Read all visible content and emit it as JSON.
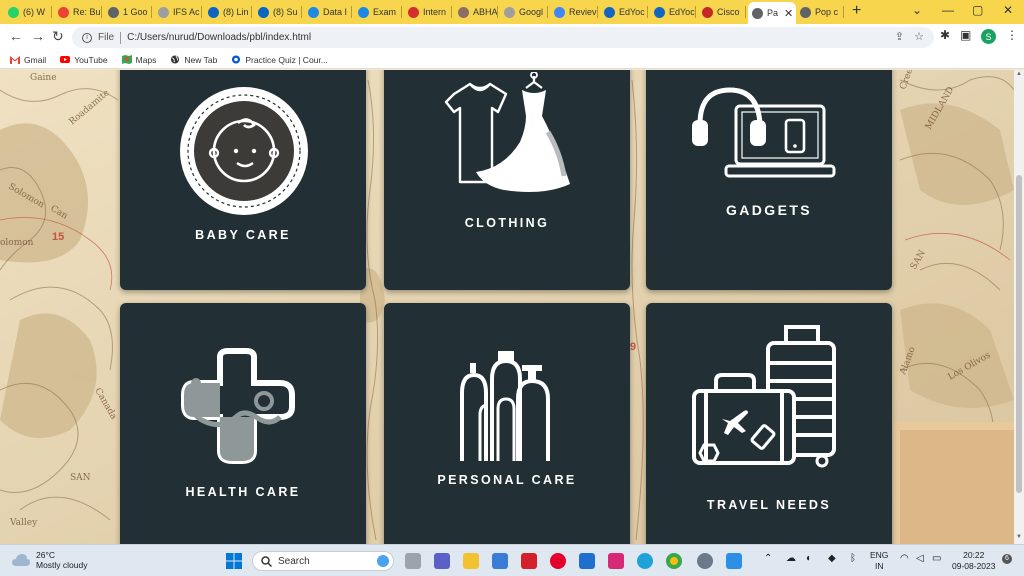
{
  "browser": {
    "tabs": [
      {
        "label": "(6) W",
        "color": "#25d366"
      },
      {
        "label": "Re: Bu",
        "color": "#ea4335"
      },
      {
        "label": "1 Goo",
        "color": "#5f6368"
      },
      {
        "label": "IFS Ac",
        "color": "#9e9e9e"
      },
      {
        "label": "(8) Lin",
        "color": "#0a66c2"
      },
      {
        "label": "(8) Su",
        "color": "#0a66c2"
      },
      {
        "label": "Data I",
        "color": "#1e88e5"
      },
      {
        "label": "Exam",
        "color": "#1e88e5"
      },
      {
        "label": "Intern",
        "color": "#d32f2f"
      },
      {
        "label": "ABHA",
        "color": "#8d6e63"
      },
      {
        "label": "Googl",
        "color": "#9e9e9e"
      },
      {
        "label": "Reviev",
        "color": "#4285f4"
      },
      {
        "label": "EdYoc",
        "color": "#1565c0"
      },
      {
        "label": "EdYoc",
        "color": "#1565c0"
      },
      {
        "label": "Cisco",
        "color": "#c62828"
      },
      {
        "label": "Pa",
        "color": "#5f6368"
      },
      {
        "label": "Pop c",
        "color": "#5f6368"
      }
    ],
    "active_tab_close": "✕",
    "new_tab": "+",
    "url_scheme": "File",
    "url": "C:/Users/nurud/Downloads/pbl/index.html",
    "profile_initial": "S"
  },
  "bookmarks": [
    {
      "label": "Gmail"
    },
    {
      "label": "YouTube"
    },
    {
      "label": "Maps"
    },
    {
      "label": "New Tab"
    },
    {
      "label": "Practice Quiz | Cour..."
    }
  ],
  "categories": [
    {
      "label": "BABY CARE",
      "icon": "baby-face-icon"
    },
    {
      "label": "CLOTHING",
      "icon": "clothing-icon"
    },
    {
      "label": "GADGETS",
      "icon": "gadgets-icon"
    },
    {
      "label": "HEALTH CARE",
      "icon": "health-cross-icon"
    },
    {
      "label": "PERSONAL CARE",
      "icon": "personal-care-icon"
    },
    {
      "label": "TRAVEL NEEDS",
      "icon": "luggage-icon"
    }
  ],
  "taskbar": {
    "temperature": "26°C",
    "weather": "Mostly cloudy",
    "search_placeholder": "Search",
    "language_top": "ENG",
    "language_bottom": "IN",
    "time": "20:22",
    "date": "09-08-2023"
  },
  "colors": {
    "card": "#223036",
    "tabstrip": "#f7d64e"
  }
}
